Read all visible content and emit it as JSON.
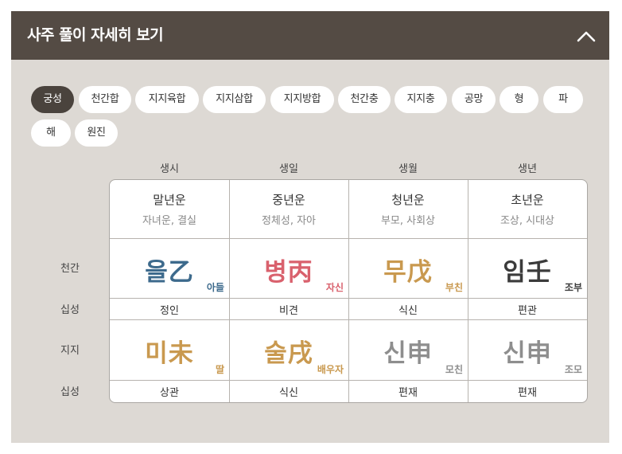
{
  "header": {
    "title": "사주 풀이 자세히 보기"
  },
  "filters": [
    "궁성",
    "천간합",
    "지지육합",
    "지지삼합",
    "지지방합",
    "천간충",
    "지지충",
    "공망",
    "형",
    "파",
    "해",
    "원진"
  ],
  "active_filter": "궁성",
  "columns": [
    "생시",
    "생일",
    "생월",
    "생년"
  ],
  "row_labels": {
    "cheongan": "천간",
    "sipseong": "십성",
    "jiji": "지지"
  },
  "periods": [
    {
      "name": "말년운",
      "desc": "자녀운, 결실"
    },
    {
      "name": "중년운",
      "desc": "정체성, 자아"
    },
    {
      "name": "청년운",
      "desc": "부모, 사회상"
    },
    {
      "name": "초년운",
      "desc": "조상, 시대상"
    }
  ],
  "cheongan": [
    {
      "char": "을乙",
      "rel": "아들",
      "color": "#3d6a8c"
    },
    {
      "char": "병丙",
      "rel": "자신",
      "color": "#d9616d"
    },
    {
      "char": "무戊",
      "rel": "부친",
      "color": "#c9994f"
    },
    {
      "char": "임壬",
      "rel": "조부",
      "color": "#3b3b3b"
    }
  ],
  "cheongan_sipseong": [
    "정인",
    "비견",
    "식신",
    "편관"
  ],
  "jiji": [
    {
      "char": "미未",
      "rel": "딸",
      "color": "#c9994f"
    },
    {
      "char": "술戌",
      "rel": "배우자",
      "color": "#c9994f"
    },
    {
      "char": "신申",
      "rel": "모친",
      "color": "#8e8e8e"
    },
    {
      "char": "신申",
      "rel": "조모",
      "color": "#8e8e8e"
    }
  ],
  "jiji_sipseong": [
    "상관",
    "식신",
    "편재",
    "편재"
  ],
  "icons": {
    "collapse": "chevron-up-icon"
  }
}
